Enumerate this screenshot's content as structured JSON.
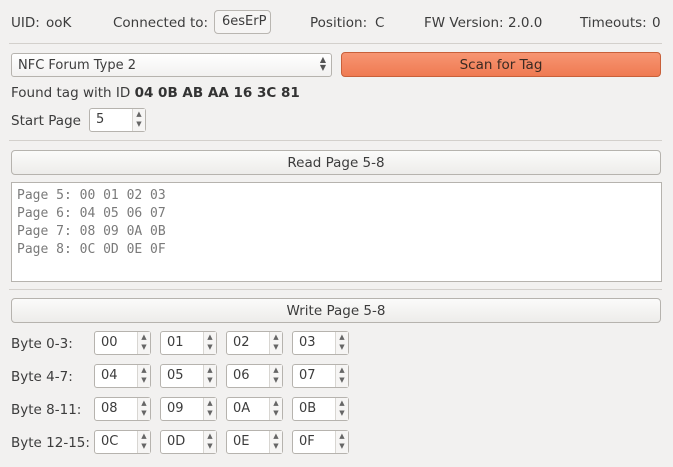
{
  "status": {
    "uid_label": "UID:",
    "uid_value": "ooK",
    "connected_label": "Connected to:",
    "connected_value": "6esErP",
    "position_label": "Position:",
    "position_value": "C",
    "fw_label": "FW Version:",
    "fw_value": "2.0.0",
    "timeouts_label": "Timeouts:",
    "timeouts_value": "0"
  },
  "tag_type": {
    "selected": "NFC Forum Type 2"
  },
  "scan_button": "Scan for Tag",
  "found": {
    "prefix": "Found tag with ID",
    "id": "04 0B AB AA 16 3C 81"
  },
  "start_page": {
    "label": "Start Page",
    "value": "5"
  },
  "read_button": "Read Page 5-8",
  "read_output": [
    "Page 5: 00 01 02 03",
    "Page 6: 04 05 06 07",
    "Page 7: 08 09 0A 0B",
    "Page 8: 0C 0D 0E 0F"
  ],
  "write_button": "Write Page 5-8",
  "write_rows": [
    {
      "label": "Byte 0-3:",
      "bytes": [
        "00",
        "01",
        "02",
        "03"
      ]
    },
    {
      "label": "Byte 4-7:",
      "bytes": [
        "04",
        "05",
        "06",
        "07"
      ]
    },
    {
      "label": "Byte 8-11:",
      "bytes": [
        "08",
        "09",
        "0A",
        "0B"
      ]
    },
    {
      "label": "Byte 12-15:",
      "bytes": [
        "0C",
        "0D",
        "0E",
        "0F"
      ]
    }
  ],
  "colors": {
    "scan_accent": "#ef7a52",
    "background": "#f2f1f0"
  }
}
